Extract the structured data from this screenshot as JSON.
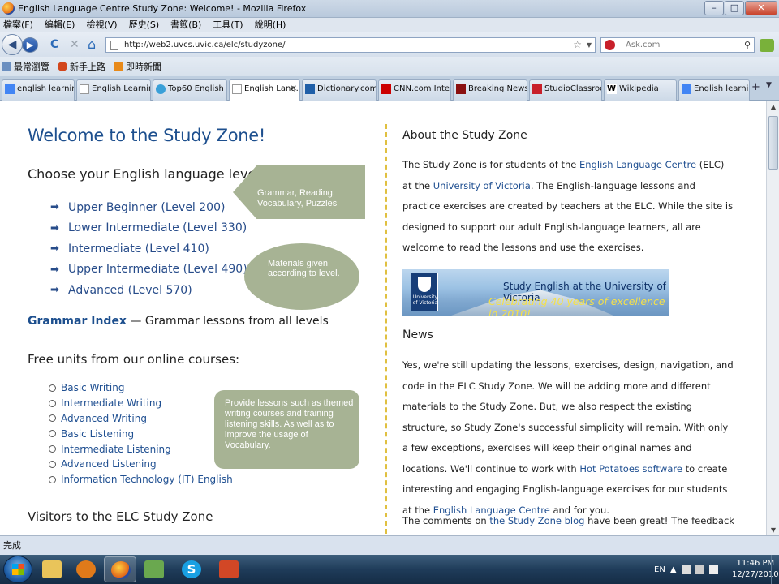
{
  "window": {
    "title": "English Language Centre Study Zone: Welcome! - Mozilla Firefox",
    "minimize": "–",
    "maximize": "□",
    "close": "✕"
  },
  "menu": [
    "檔案(F)",
    "編輯(E)",
    "檢視(V)",
    "歷史(S)",
    "書籤(B)",
    "工具(T)",
    "說明(H)"
  ],
  "nav": {
    "back": "◀",
    "forward": "▶",
    "reload": "C",
    "stop": "✕",
    "home": "⌂",
    "url": "http://web2.uvcs.uvic.ca/elc/studyzone/",
    "search_placeholder": "Ask.com"
  },
  "bookmarks": [
    {
      "label": "最常瀏覽",
      "icon": "most-visited-icon",
      "color": "#6b8fc0"
    },
    {
      "label": "新手上路",
      "icon": "firefox-icon",
      "color": "#d2461c"
    },
    {
      "label": "即時新聞",
      "icon": "rss-icon",
      "color": "#e88a1a"
    }
  ],
  "tabs": [
    {
      "label": "english learning ...",
      "favicon_color": "#4285f4"
    },
    {
      "label": "English Learning ...",
      "favicon_color": "#ffffff"
    },
    {
      "label": "Top60  English L...",
      "favicon_color": "#3aa0d8"
    },
    {
      "label": "English Lang...",
      "favicon_color": "#ffffff",
      "active": true
    },
    {
      "label": "Dictionary.com",
      "favicon_color": "#1f5fa8"
    },
    {
      "label": "CNN.com Intern...",
      "favicon_color": "#cc0000"
    },
    {
      "label": "Breaking News, ...",
      "favicon_color": "#8a1010"
    },
    {
      "label": "StudioClassroom...",
      "favicon_color": "#c8202a"
    },
    {
      "label": "Wikipedia",
      "favicon_color": "#ffffff"
    },
    {
      "label": "English learning ...",
      "favicon_color": "#4285f4"
    }
  ],
  "page": {
    "welcome": "Welcome to the Study Zone!",
    "choose_level": "Choose your English language level:",
    "levels": [
      "Upper Beginner (Level 200)",
      "Lower Intermediate (Level 330)",
      "Intermediate (Level 410)",
      "Upper Intermediate (Level 490)",
      "Advanced (Level 570)"
    ],
    "grammar_link": "Grammar Index",
    "grammar_rest": " — Grammar lessons from all levels",
    "free_units_heading": "Free units from our online courses:",
    "units": [
      "Basic Writing",
      "Intermediate Writing",
      "Advanced Writing",
      "Basic Listening",
      "Intermediate Listening",
      "Advanced Listening",
      "Information Technology (IT) English"
    ],
    "visitors_heading": "Visitors to the ELC Study Zone",
    "about_heading": "About the Study Zone",
    "about": {
      "p1": "The Study Zone is for students of the ",
      "link1": "English Language Centre",
      "p2": " (ELC) at the ",
      "link2": "University of Victoria",
      "p3": ". The English-language lessons and practice exercises are created by teachers at the ELC. While the site is designed to support our adult English-language learners, all are welcome to read the lessons and use the exercises."
    },
    "banner": {
      "crest_text": "University of Victoria",
      "line1": "Study English at the University of Victoria",
      "line2": "Celebrating 40 years of excellence in 2010!"
    },
    "news_heading": "News",
    "news": {
      "p1": "Yes, we're still updating the lessons, exercises, design, navigation, and code in the ELC Study Zone. We will be adding more and different materials to the Study Zone. But, we also respect the existing structure, so Study Zone's successful simplicity will remain. With only a few exceptions, exercises will keep their original names and locations. We'll continue to work with ",
      "link1": "Hot Potatoes software",
      "p2": " to create interesting and engaging English-language exercises for our students at the ",
      "link2": "English Language Centre",
      "p3": " and for you."
    },
    "comments": {
      "p1": "The comments on ",
      "link1": "the Study Zone blog",
      "p2": " have been great! The feedback and"
    }
  },
  "callouts": {
    "arrow": "Grammar, Reading, Vocabulary, Puzzles",
    "oval": "Materials given according to level.",
    "box": "Provide lessons  such as themed writing courses and training listening skills. As well as to improve the usage of Vocabulary."
  },
  "status": "完成",
  "taskbar": {
    "apps": [
      {
        "name": "explorer",
        "color": "#e9c45a"
      },
      {
        "name": "media-player",
        "color": "#e07a1a"
      },
      {
        "name": "firefox",
        "color": "#e0651a",
        "active": true
      },
      {
        "name": "network",
        "color": "#6aa84f"
      },
      {
        "name": "skype",
        "color": "#19a0e3"
      },
      {
        "name": "powerpoint",
        "color": "#d24726"
      }
    ],
    "language": "EN",
    "time": "11:46 PM",
    "date": "12/27/2010"
  }
}
